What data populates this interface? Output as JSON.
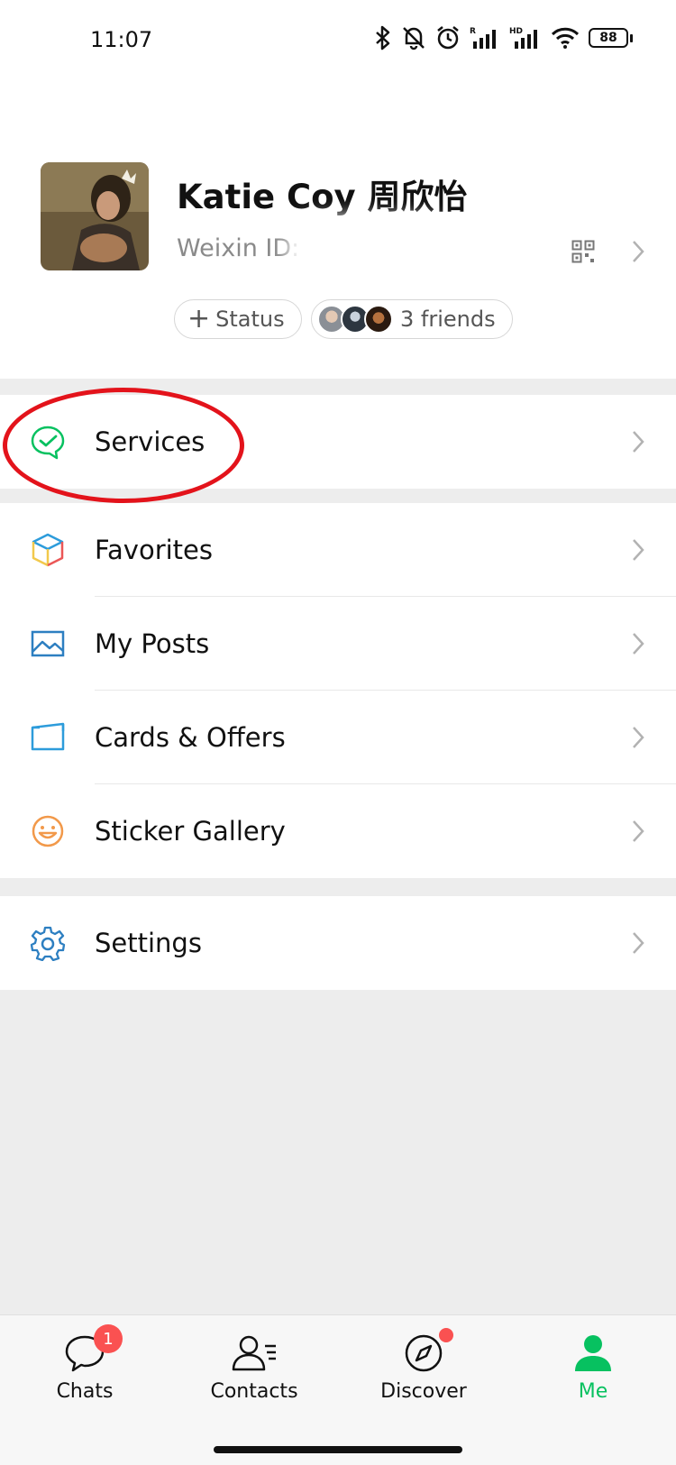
{
  "status_bar": {
    "time": "11:07",
    "battery": "88",
    "icons": [
      "bluetooth-icon",
      "mute-bell-icon",
      "alarm-icon",
      "signal-r-icon",
      "signal-hd-icon",
      "wifi-icon",
      "battery-icon"
    ]
  },
  "profile": {
    "name": "Katie Coy 周欣怡",
    "weixin_id": "Weixin ID: k",
    "status_label": "Status",
    "friends_label": "3 friends"
  },
  "menu": {
    "services": "Services",
    "favorites": "Favorites",
    "my_posts": "My Posts",
    "cards_offers": "Cards & Offers",
    "sticker_gallery": "Sticker Gallery",
    "settings": "Settings"
  },
  "tabs": {
    "chats": "Chats",
    "chats_badge": "1",
    "contacts": "Contacts",
    "discover": "Discover",
    "me": "Me"
  },
  "colors": {
    "accent": "#07c160",
    "badge": "#fa5151",
    "annotation": "#e3131b"
  }
}
